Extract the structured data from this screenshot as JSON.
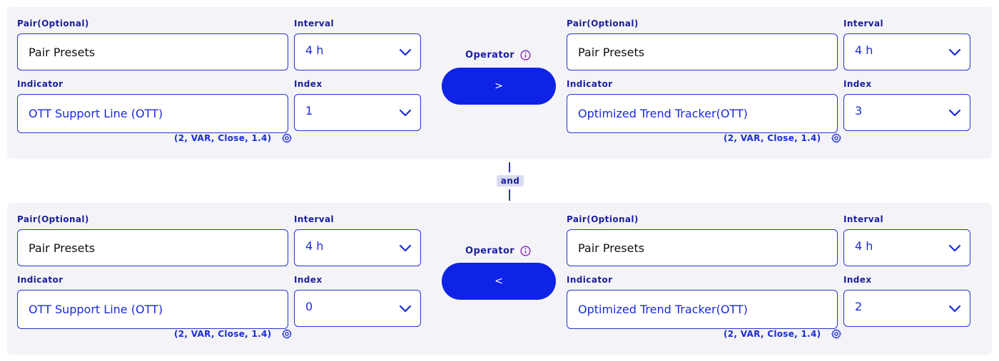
{
  "labels": {
    "pair": "Pair(Optional)",
    "interval": "Interval",
    "indicator": "Indicator",
    "index": "Index",
    "operator": "Operator"
  },
  "connector": "and",
  "conditions": [
    {
      "left": {
        "pair": "Pair Presets",
        "interval": "4 h",
        "indicator": "OTT Support Line (OTT)",
        "index": "1",
        "params": "(2, VAR, Close, 1.4)"
      },
      "operator": ">",
      "right": {
        "pair": "Pair Presets",
        "interval": "4 h",
        "indicator": "Optimized Trend Tracker(OTT)",
        "index": "3",
        "params": "(2, VAR, Close, 1.4)"
      }
    },
    {
      "left": {
        "pair": "Pair Presets",
        "interval": "4 h",
        "indicator": "OTT Support Line (OTT)",
        "index": "0",
        "params": "(2, VAR, Close, 1.4)"
      },
      "operator": "<",
      "right": {
        "pair": "Pair Presets",
        "interval": "4 h",
        "indicator": "Optimized Trend Tracker(OTT)",
        "index": "2",
        "params": "(2, VAR, Close, 1.4)"
      }
    }
  ],
  "icons": {
    "chevron": "chevron-down-icon",
    "gear": "gear-icon",
    "info": "info-icon"
  },
  "colors": {
    "accent": "#0f23e6",
    "text": "#1a1f9c",
    "panel_bg": "#f4f4f8",
    "border": "#2a33c9"
  }
}
